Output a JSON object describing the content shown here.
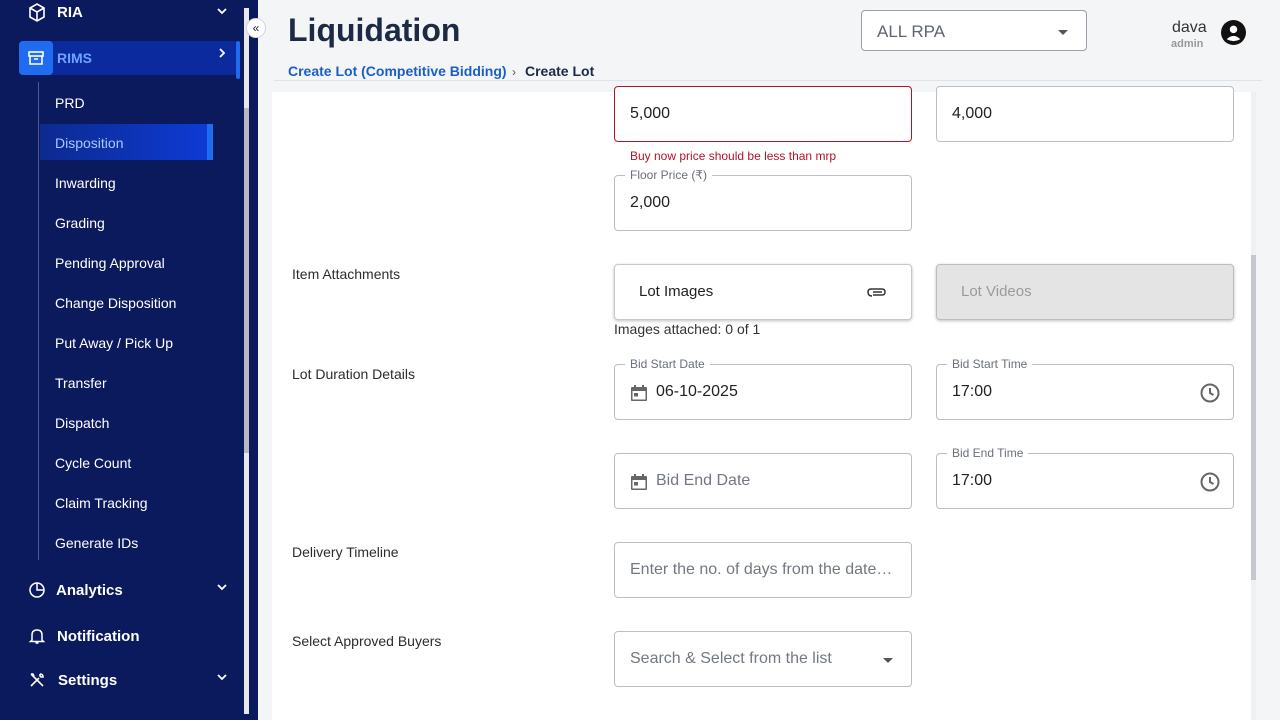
{
  "sidebar": {
    "items": [
      {
        "label": "RIA",
        "icon": "box-icon"
      },
      {
        "label": "RIMS",
        "icon": "archive-icon"
      },
      {
        "label": "Analytics",
        "icon": "pie-chart-icon"
      },
      {
        "label": "Notification",
        "icon": "bell-icon"
      },
      {
        "label": "Settings",
        "icon": "tools-icon"
      }
    ],
    "sub_items": [
      "PRD",
      "Disposition",
      "Inwarding",
      "Grading",
      "Pending Approval",
      "Change Disposition",
      "Put Away / Pick Up",
      "Transfer",
      "Dispatch",
      "Cycle Count",
      "Claim Tracking",
      "Generate IDs"
    ],
    "active_sub": "Disposition",
    "collapse_glyph": "«"
  },
  "header": {
    "title": "Liquidation",
    "rpa_select": "ALL RPA",
    "user_name": "dava",
    "user_role": "admin"
  },
  "breadcrumb": {
    "parent": "Create Lot (Competitive Bidding)",
    "separator": "›",
    "current": "Create Lot"
  },
  "form": {
    "buy_now_price": "5,000",
    "buy_now_error": "Buy now price should be less than mrp",
    "other_price": "4,000",
    "floor_price_label": "Floor Price (₹)",
    "floor_price": "2,000",
    "attachments_label": "Item Attachments",
    "lot_images": "Lot Images",
    "lot_videos": "Lot Videos",
    "images_attached": "Images attached: 0 of 1",
    "duration_label": "Lot Duration Details",
    "bid_start_date_label": "Bid Start Date",
    "bid_start_date": "06-10-2025",
    "bid_start_time_label": "Bid Start Time",
    "bid_start_time": "17:00",
    "bid_end_date_placeholder": "Bid End Date",
    "bid_end_time_label": "Bid End Time",
    "bid_end_time": "17:00",
    "delivery_label": "Delivery Timeline",
    "delivery_placeholder": "Enter the no. of days from the date of bid end",
    "buyers_label": "Select Approved Buyers",
    "buyers_placeholder": "Search & Select from the list"
  },
  "colors": {
    "sidebar_bg": "#0b1a5c",
    "accent": "#1f6cf0",
    "error": "#b3122b",
    "link": "#1a5fc6"
  }
}
